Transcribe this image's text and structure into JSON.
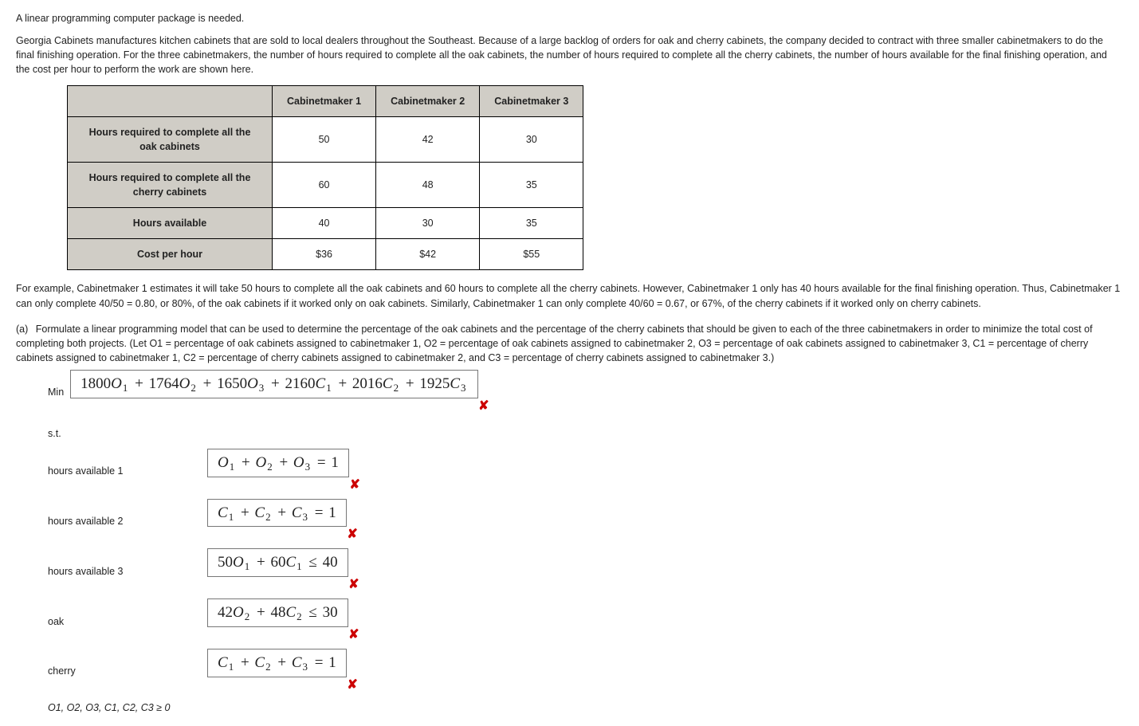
{
  "intro1": "A linear programming computer package is needed.",
  "intro2": "Georgia Cabinets manufactures kitchen cabinets that are sold to local dealers throughout the Southeast. Because of a large backlog of orders for oak and cherry cabinets, the company decided to contract with three smaller cabinetmakers to do the final finishing operation. For the three cabinetmakers, the number of hours required to complete all the oak cabinets, the number of hours required to complete all the cherry cabinets, the number of hours available for the final finishing operation, and the cost per hour to perform the work are shown here.",
  "table": {
    "headers": [
      "",
      "Cabinetmaker 1",
      "Cabinetmaker 2",
      "Cabinetmaker 3"
    ],
    "rows": [
      {
        "label": "Hours required to complete all the oak cabinets",
        "c1": "50",
        "c2": "42",
        "c3": "30"
      },
      {
        "label": "Hours required to complete all the cherry cabinets",
        "c1": "60",
        "c2": "48",
        "c3": "35"
      },
      {
        "label": "Hours available",
        "c1": "40",
        "c2": "30",
        "c3": "35"
      },
      {
        "label": "Cost per hour",
        "c1": "$36",
        "c2": "$42",
        "c3": "$55"
      }
    ]
  },
  "explain": "For example, Cabinetmaker 1 estimates it will take 50 hours to complete all the oak cabinets and 60 hours to complete all the cherry cabinets. However, Cabinetmaker 1 only has 40 hours available for the final finishing operation. Thus, Cabinetmaker 1 can only complete 40/50 = 0.80, or 80%, of the oak cabinets if it worked only on oak cabinets. Similarly, Cabinetmaker 1 can only complete 40/60 = 0.67, or 67%, of the cherry cabinets if it worked only on cherry cabinets.",
  "part_a_label": "(a)",
  "part_a_text": "Formulate a linear programming model that can be used to determine the percentage of the oak cabinets and the percentage of the cherry cabinets that should be given to each of the three cabinetmakers in order to minimize the total cost of completing both projects. (Let O1 = percentage of oak cabinets assigned to cabinetmaker 1, O2 = percentage of oak cabinets assigned to cabinetmaker 2, O3 = percentage of oak cabinets assigned to cabinetmaker 3, C1 = percentage of cherry cabinets assigned to cabinetmaker 1, C2 = percentage of cherry cabinets assigned to cabinetmaker 2, and C3 = percentage of cherry cabinets assigned to cabinetmaker 3.)",
  "objective": {
    "label": "Min",
    "terms": [
      {
        "coef": "1800",
        "var": "O",
        "sub": "1"
      },
      {
        "coef": "1764",
        "var": "O",
        "sub": "2"
      },
      {
        "coef": "1650",
        "var": "O",
        "sub": "3"
      },
      {
        "coef": "2160",
        "var": "C",
        "sub": "1"
      },
      {
        "coef": "2016",
        "var": "C",
        "sub": "2"
      },
      {
        "coef": "1925",
        "var": "C",
        "sub": "3"
      }
    ],
    "wrong": true
  },
  "st_label": "s.t.",
  "constraints": [
    {
      "label": "hours available 1",
      "expr": [
        {
          "coef": "",
          "var": "O",
          "sub": "1"
        },
        {
          "coef": "",
          "var": "O",
          "sub": "2"
        },
        {
          "coef": "",
          "var": "O",
          "sub": "3"
        }
      ],
      "rel": "=",
      "rhs": "1",
      "wrong": true
    },
    {
      "label": "hours available 2",
      "expr": [
        {
          "coef": "",
          "var": "C",
          "sub": "1"
        },
        {
          "coef": "",
          "var": "C",
          "sub": "2"
        },
        {
          "coef": "",
          "var": "C",
          "sub": "3"
        }
      ],
      "rel": "=",
      "rhs": "1",
      "wrong": true
    },
    {
      "label": "hours available 3",
      "expr": [
        {
          "coef": "50",
          "var": "O",
          "sub": "1"
        },
        {
          "coef": "60",
          "var": "C",
          "sub": "1"
        }
      ],
      "rel": "≤",
      "rhs": "40",
      "wrong": true
    },
    {
      "label": "oak",
      "expr": [
        {
          "coef": "42",
          "var": "O",
          "sub": "2"
        },
        {
          "coef": "48",
          "var": "C",
          "sub": "2"
        }
      ],
      "rel": "≤",
      "rhs": "30",
      "wrong": true
    },
    {
      "label": "cherry",
      "expr": [
        {
          "coef": "",
          "var": "C",
          "sub": "1"
        },
        {
          "coef": "",
          "var": "C",
          "sub": "2"
        },
        {
          "coef": "",
          "var": "C",
          "sub": "3"
        }
      ],
      "rel": "=",
      "rhs": "1",
      "wrong": true
    }
  ],
  "nonneg": "O1, O2, O3, C1, C2, C3 ≥ 0",
  "wrong_glyph": "✘"
}
